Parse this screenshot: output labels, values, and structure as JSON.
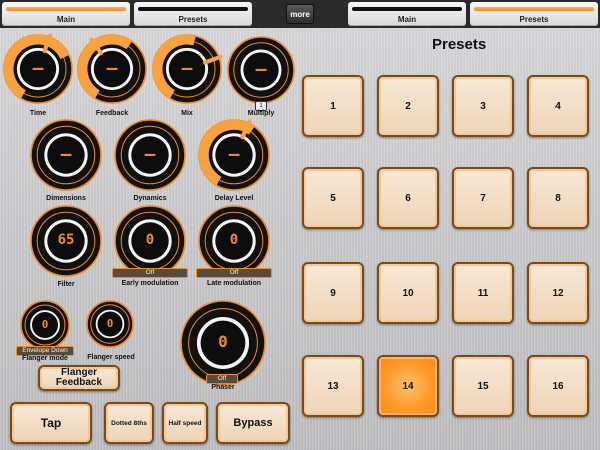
{
  "top_tabs": {
    "left_main": "Main",
    "left_presets": "Presets",
    "more": "more",
    "right_main": "Main",
    "right_presets": "Presets"
  },
  "colors": {
    "accent": "#f08a23",
    "knob_black": "#111111",
    "active_preset": "#ff9a2a"
  },
  "knobs": {
    "time": {
      "label": "Time",
      "readout": "—"
    },
    "feedback": {
      "label": "Feedback",
      "readout": "—"
    },
    "mix": {
      "label": "Mix",
      "readout": "—"
    },
    "multiply": {
      "label": "Multiply",
      "readout": "—",
      "badge": "1"
    },
    "dimensions": {
      "label": "Dimensions",
      "readout": "—"
    },
    "dynamics": {
      "label": "Dynamics",
      "readout": "—"
    },
    "delay_level": {
      "label": "Delay Level",
      "readout": "—"
    },
    "filter": {
      "label": "Filter",
      "readout": "65"
    },
    "early_mod": {
      "label": "Early modulation",
      "readout": "0",
      "badge": "Off"
    },
    "late_mod": {
      "label": "Late modulation",
      "readout": "0",
      "badge": "Off"
    },
    "flanger_mode": {
      "label": "Flanger mode",
      "readout": "0",
      "badge": "Envelope Down"
    },
    "flanger_speed": {
      "label": "Flanger speed",
      "readout": "0"
    },
    "phaser": {
      "label": "Phaser",
      "readout": "0",
      "badge": "Off"
    }
  },
  "buttons": {
    "flanger_feedback": "Flanger Feedback",
    "tap": "Tap",
    "dotted": "Dotted 8ths",
    "half_speed": "Half speed",
    "bypass": "Bypass"
  },
  "presets": {
    "title": "Presets",
    "items": [
      "1",
      "2",
      "3",
      "4",
      "5",
      "6",
      "7",
      "8",
      "9",
      "10",
      "11",
      "12",
      "13",
      "14",
      "15",
      "16"
    ],
    "active": "14"
  }
}
